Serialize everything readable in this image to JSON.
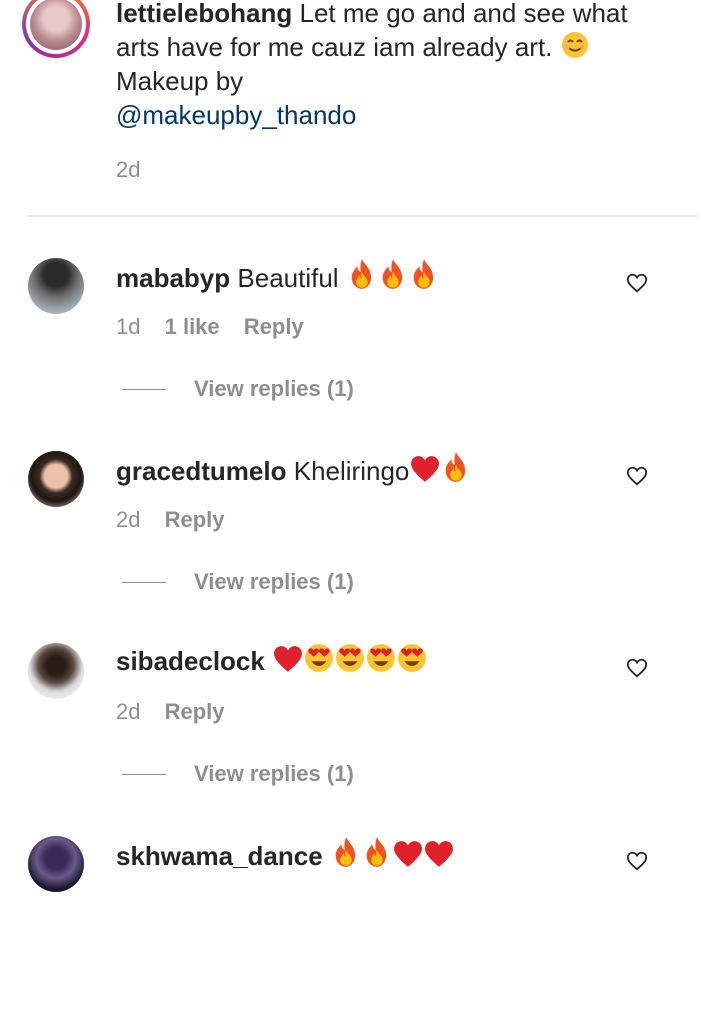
{
  "caption": {
    "username": "lettielebohang",
    "line1": "Let me go and and see what",
    "line2": "arts have for me cauz iam already art.",
    "line3": "Makeup by",
    "mention": "@makeupby_thando",
    "time": "2d"
  },
  "comments": [
    {
      "username": "mababyp",
      "text": "Beautiful",
      "emojis": [
        "fire-emoji",
        "fire-emoji",
        "fire-emoji"
      ],
      "time": "1d",
      "likes": "1 like",
      "reply": "Reply",
      "view_replies": "View replies (1)"
    },
    {
      "username": "gracedtumelo",
      "text": "Kheliringo",
      "emojis": [
        "red-heart-emoji",
        "fire-emoji"
      ],
      "time": "2d",
      "reply": "Reply",
      "view_replies": "View replies (1)"
    },
    {
      "username": "sibadeclock",
      "text": "",
      "emojis": [
        "red-heart-emoji",
        "heart-eyes-emoji",
        "heart-eyes-emoji",
        "heart-eyes-emoji",
        "heart-eyes-emoji"
      ],
      "time": "2d",
      "reply": "Reply",
      "view_replies": "View replies (1)"
    },
    {
      "username": "skhwama_dance",
      "text": "",
      "emojis": [
        "fire-emoji",
        "fire-emoji",
        "red-heart-emoji",
        "red-heart-emoji"
      ]
    }
  ]
}
